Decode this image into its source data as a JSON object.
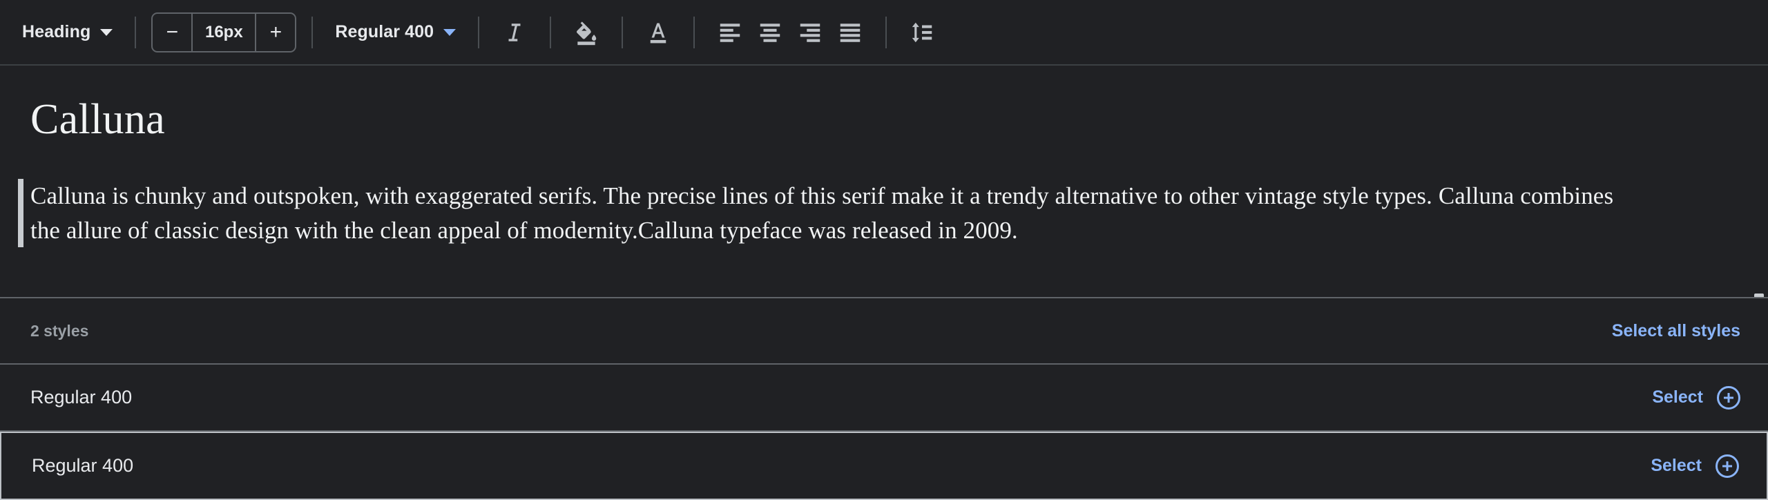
{
  "toolbar": {
    "block_style": {
      "label": "Heading",
      "icon": "chevron-down-icon"
    },
    "font_size": {
      "value": "16px",
      "decrease": "−",
      "increase": "+"
    },
    "font_weight": {
      "label": "Regular 400",
      "icon": "chevron-down-icon"
    },
    "buttons": [
      {
        "name": "italic-button",
        "icon": "italic-icon",
        "title": "Italic"
      },
      {
        "name": "fill-color-button",
        "icon": "paint-bucket-icon",
        "title": "Fill color"
      },
      {
        "name": "text-color-button",
        "icon": "text-color-icon",
        "title": "Text color"
      },
      {
        "name": "align-left-button",
        "icon": "align-left-icon",
        "title": "Align left"
      },
      {
        "name": "align-center-button",
        "icon": "align-center-icon",
        "title": "Align center"
      },
      {
        "name": "align-right-button",
        "icon": "align-right-icon",
        "title": "Align right"
      },
      {
        "name": "align-justify-button",
        "icon": "align-justify-icon",
        "title": "Justify"
      },
      {
        "name": "line-height-button",
        "icon": "line-height-icon",
        "title": "Line height"
      }
    ]
  },
  "document": {
    "heading": "Calluna",
    "paragraph": "Calluna is chunky and outspoken, with exaggerated serifs. The precise lines of this serif make it a trendy alternative to other vintage style types. Calluna combines the allure of classic design with the clean appeal of modernity.Calluna typeface was released in 2009."
  },
  "styles_panel": {
    "count_label": "2 styles",
    "select_all_label": "Select all styles",
    "rows": [
      {
        "name": "Regular 400",
        "action_label": "Select",
        "action_icon": "plus-circle-icon",
        "focused": false
      },
      {
        "name": "Regular 400",
        "action_label": "Select",
        "action_icon": "plus-circle-icon",
        "focused": true
      }
    ]
  },
  "colors": {
    "background": "#202124",
    "border": "#5f6368",
    "text": "#e8eaed",
    "muted": "#9aa0a6",
    "accent_blue": "#8ab4f8",
    "icon": "#bdc1c6"
  }
}
